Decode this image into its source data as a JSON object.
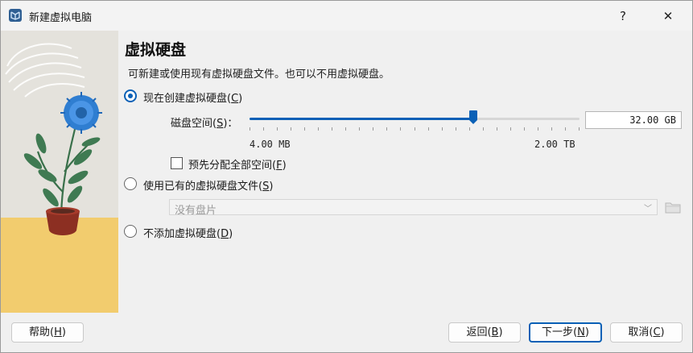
{
  "window": {
    "title": "新建虚拟电脑"
  },
  "titlebar": {
    "help_glyph": "?",
    "close_glyph": "✕"
  },
  "page": {
    "title": "虚拟硬盘",
    "description": "可新建或使用现有虚拟硬盘文件。也可以不用虚拟硬盘。"
  },
  "options": {
    "create_new": {
      "label": "现在创建虚拟硬盘",
      "mnemonic": "C",
      "selected": true
    },
    "disk_size": {
      "label": "磁盘空间",
      "mnemonic": "S",
      "value": "32.00 GB",
      "min_label": "4.00 MB",
      "max_label": "2.00 TB",
      "slider_fraction": 0.677
    },
    "preallocate": {
      "label": "预先分配全部空间",
      "mnemonic": "F",
      "checked": false
    },
    "use_existing": {
      "label": "使用已有的虚拟硬盘文件",
      "mnemonic": "S",
      "selected": false
    },
    "existing_combo": {
      "value": "没有盘片",
      "enabled": false
    },
    "no_disk": {
      "label": "不添加虚拟硬盘",
      "mnemonic": "D",
      "selected": false
    }
  },
  "footer": {
    "help": {
      "label": "帮助",
      "mnemonic": "H"
    },
    "back": {
      "label": "返回",
      "mnemonic": "B"
    },
    "next": {
      "label": "下一步",
      "mnemonic": "N"
    },
    "cancel": {
      "label": "取消",
      "mnemonic": "C"
    }
  },
  "colors": {
    "accent": "#0a60b6",
    "panel": "#f0f0f0",
    "art_background": "#e4e2dc",
    "art_floor": "#f2cc6e"
  }
}
